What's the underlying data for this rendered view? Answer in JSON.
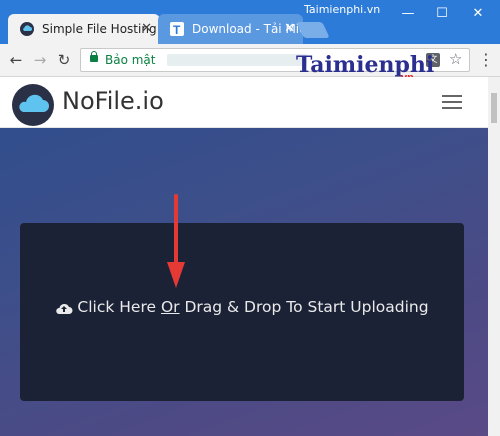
{
  "browser": {
    "tabs": [
      {
        "title": "Simple File Hosting",
        "active": true
      },
      {
        "title": "Download - Tải Miễn phí",
        "active": false
      }
    ],
    "watermark_top": "Taimienphi.vn",
    "secure_label": "Bảo mật",
    "window_controls": [
      "—",
      "☐",
      "✕"
    ]
  },
  "watermark": {
    "brand": "Taimienphi",
    "suffix": ".vn"
  },
  "site": {
    "logo_text": "NoFile.io",
    "upload_prompt_prefix": "Click Here ",
    "upload_prompt_or": "Or",
    "upload_prompt_suffix": " Drag & Drop To Start Uploading"
  },
  "colors": {
    "tab_strip": "#2c7bd9",
    "accent_arrow": "#e53935",
    "dropzone": "#1c2236"
  }
}
